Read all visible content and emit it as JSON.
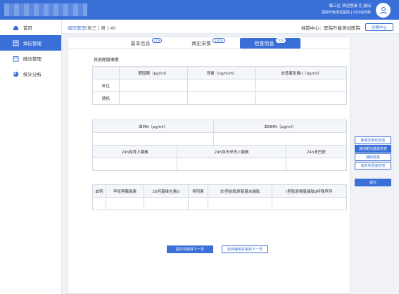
{
  "header": {
    "user_line1": "韩三区  欢迎登录",
    "logout": "退出",
    "user_line2": "医院升级测试医院 | 内分泌内科"
  },
  "sidebar": {
    "items": [
      {
        "label": "首页",
        "icon": "home-icon"
      },
      {
        "label": "病历管理",
        "icon": "record-icon",
        "active": true
      },
      {
        "label": "随访管理",
        "icon": "followup-icon"
      },
      {
        "label": "统计分析",
        "icon": "chart-icon"
      }
    ]
  },
  "breadcrumb": {
    "link": "病历管理",
    "rest": "/张三 | 男 | 40"
  },
  "center_label": "当前中心：医院升级测试医院",
  "switch_center": "切换中心",
  "tabs": [
    {
      "label": "基本信息",
      "badge": "17%"
    },
    {
      "label": "病史采集",
      "badge": "100%"
    },
    {
      "label": "检查信息",
      "badge": "50%",
      "active": true
    }
  ],
  "section_title": "其他靶腺激素",
  "table1": {
    "headers": [
      "",
      "醛固酮（pg/ml）",
      "肾素（ng/ml/h）",
      "血管紧张素II（pg/ml）"
    ],
    "rows": [
      "卧位",
      "随机"
    ]
  },
  "table2": {
    "headers": [
      "血MN（pg/ml）",
      "血NMN（pg/ml）"
    ]
  },
  "table3": {
    "headers": [
      "24h尿肾上腺素",
      "24h尿去甲肾上腺素",
      "24h多巴胺"
    ]
  },
  "table4": {
    "headers": [
      "血钙",
      "甲状旁腺激素",
      "25羟基维生素D",
      "骨钙素",
      "总I型前胶原氨基末端肽",
      "I型胶原羧基端肽β特殊序列"
    ]
  },
  "buttons": {
    "submit_next": "提交并跳转下一页",
    "abandon_next": "放弃编辑并跳转下一页",
    "submit": "提交"
  },
  "right_nav": [
    {
      "label": "肿瘤定制化检查"
    },
    {
      "label": "其他靶向激素检查",
      "active": true
    },
    {
      "label": "辅助检查"
    },
    {
      "label": "其他实验室检查"
    }
  ]
}
